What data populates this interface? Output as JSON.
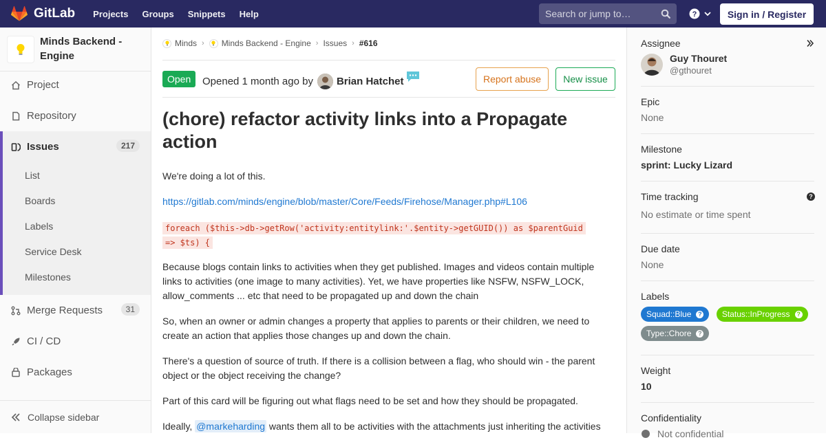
{
  "navbar": {
    "brand": "GitLab",
    "links": [
      "Projects",
      "Groups",
      "Snippets",
      "Help"
    ],
    "search_placeholder": "Search or jump to…",
    "signin_label": "Sign in / Register"
  },
  "sidebar": {
    "project_name": "Minds Backend - Engine",
    "items": [
      {
        "label": "Project",
        "icon": "home-icon"
      },
      {
        "label": "Repository",
        "icon": "doc-icon"
      },
      {
        "label": "Issues",
        "icon": "issues-icon",
        "count": "217"
      },
      {
        "label": "Merge Requests",
        "icon": "merge-icon",
        "count": "31"
      },
      {
        "label": "CI / CD",
        "icon": "rocket-icon"
      },
      {
        "label": "Packages",
        "icon": "package-icon"
      }
    ],
    "issues_sub": [
      "List",
      "Boards",
      "Labels",
      "Service Desk",
      "Milestones"
    ],
    "collapse_label": "Collapse sidebar"
  },
  "breadcrumb": {
    "group": "Minds",
    "project": "Minds Backend - Engine",
    "section": "Issues",
    "current": "#616"
  },
  "issue": {
    "status": "Open",
    "opened_text": "Opened 1 month ago by",
    "author": "Brian Hatchet",
    "report_label": "Report abuse",
    "new_issue_label": "New issue",
    "title": "(chore) refactor activity links into a Propagate action",
    "p1": "We're doing a lot of this.",
    "link": "https://gitlab.com/minds/engine/blob/master/Core/Feeds/Firehose/Manager.php#L106",
    "code_line1": "foreach ($this->db->getRow('activity:entitylink:'.$entity->getGUID()) as $parentGuid",
    "code_line2": "=> $ts) {",
    "p2": "Because blogs contain links to activities when they get published. Images and videos contain multiple links to activities (one image to many activities). Yet, we have properties like NSFW, NSFW_LOCK, allow_comments ... etc that need to be propagated up and down the chain",
    "p3": "So, when an owner or admin changes a property that applies to parents or their children, we need to create an action that applies those changes up and down the chain.",
    "p4": "There's a question of source of truth. If there is a collision between a flag, who should win - the parent object or the object receiving the change?",
    "p5": "Part of this card will be figuring out what flags need to be set and how they should be propagated.",
    "p6_prefix": "Ideally,",
    "p6_mention": "@markeharding",
    "p6_suffix": "wants them all to be activities with the attachments just inheriting the activities"
  },
  "right": {
    "assignee_label": "Assignee",
    "assignee_name": "Guy Thouret",
    "assignee_handle": "@gthouret",
    "epic_label": "Epic",
    "epic_value": "None",
    "milestone_label": "Milestone",
    "milestone_value": "sprint: Lucky Lizard",
    "time_label": "Time tracking",
    "time_value": "No estimate or time spent",
    "due_label": "Due date",
    "due_value": "None",
    "labels_label": "Labels",
    "labels": [
      {
        "text": "Squad::Blue",
        "color": "#1f78d1"
      },
      {
        "text": "Status::InProgress",
        "color": "#69d100"
      },
      {
        "text": "Type::Chore",
        "color": "#7f8c8d"
      }
    ],
    "weight_label": "Weight",
    "weight_value": "10",
    "confidentiality_label": "Confidentiality",
    "confidentiality_value": "Not confidential"
  }
}
